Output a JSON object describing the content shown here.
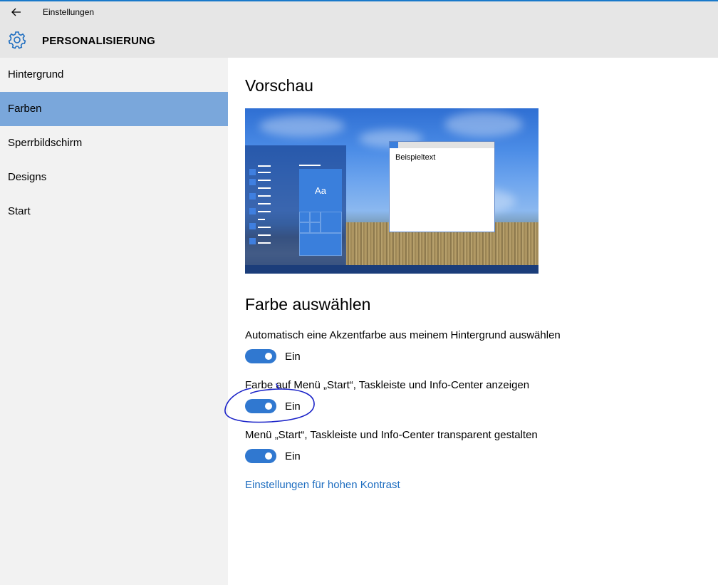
{
  "titlebar": {
    "back_icon": "back-arrow-icon",
    "title": "Einstellungen"
  },
  "header": {
    "icon": "gear-icon",
    "title": "PERSONALISIERUNG"
  },
  "sidebar": {
    "items": [
      {
        "label": "Hintergrund",
        "selected": false
      },
      {
        "label": "Farben",
        "selected": true
      },
      {
        "label": "Sperrbildschirm",
        "selected": false
      },
      {
        "label": "Designs",
        "selected": false
      },
      {
        "label": "Start",
        "selected": false
      }
    ]
  },
  "main": {
    "preview_heading": "Vorschau",
    "preview": {
      "tile_label": "Aa",
      "sample_text": "Beispieltext"
    },
    "color_heading": "Farbe auswählen",
    "settings": [
      {
        "label": "Automatisch eine Akzentfarbe aus meinem Hintergrund auswählen",
        "state": "Ein",
        "on": true
      },
      {
        "label": "Farbe auf Menü „Start“, Taskleiste und Info-Center anzeigen",
        "state": "Ein",
        "on": true
      },
      {
        "label": "Menü „Start“, Taskleiste und Info-Center transparent gestalten",
        "state": "Ein",
        "on": true
      }
    ],
    "high_contrast_link": "Einstellungen für hohen Kontrast"
  },
  "colors": {
    "accent": "#3078d0",
    "selected_nav": "#7aa7db",
    "link": "#1f6ec0",
    "annotation_ink": "#1a22c8"
  }
}
